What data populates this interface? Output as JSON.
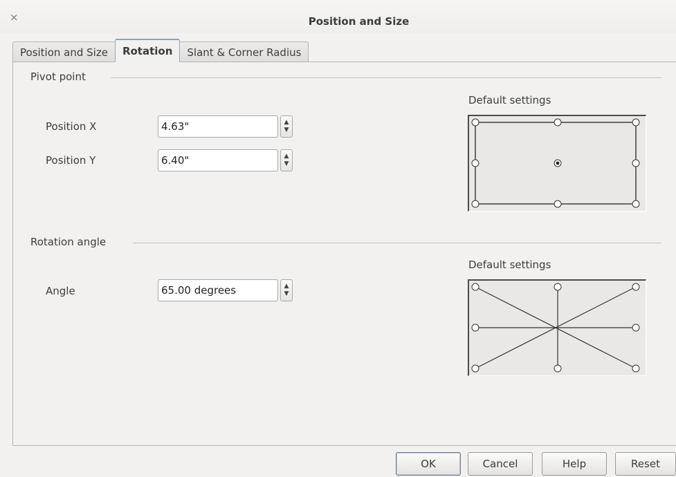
{
  "window": {
    "title": "Position and Size",
    "close_glyph": "×"
  },
  "tabs": [
    {
      "label": "Position and Size",
      "active": false
    },
    {
      "label": "Rotation",
      "active": true
    },
    {
      "label": "Slant & Corner Radius",
      "active": false
    }
  ],
  "pivot": {
    "group_label": "Pivot point",
    "x_label": "Position X",
    "y_label": "Position Y",
    "x_value": "4.63\"",
    "y_value": "6.40\"",
    "defaults_label": "Default settings"
  },
  "rotation": {
    "group_label": "Rotation angle",
    "angle_label": "Angle",
    "angle_value": "65.00 degrees",
    "defaults_label": "Default settings"
  },
  "buttons": {
    "ok": "OK",
    "cancel": "Cancel",
    "help": "Help",
    "reset": "Reset"
  },
  "spin_glyphs": {
    "up": "▲",
    "down": "▼"
  },
  "selected_pivot_point": "center"
}
